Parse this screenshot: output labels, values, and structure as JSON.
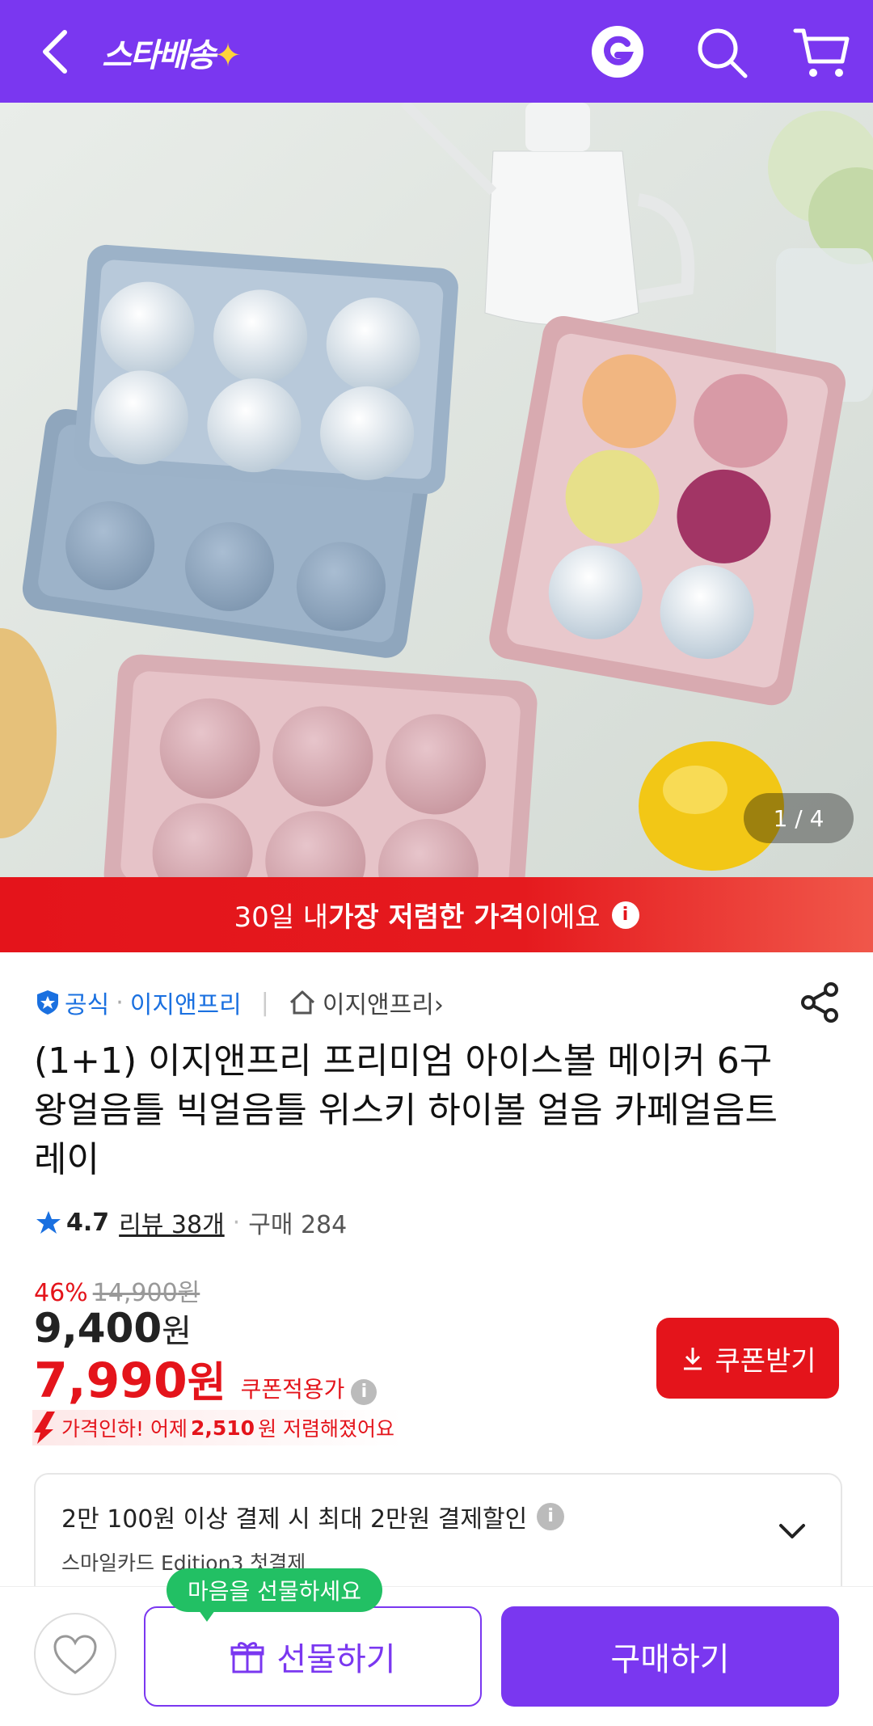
{
  "topbar": {
    "logo_text": "스타배송",
    "logo_spark": "✦",
    "icons": [
      "back-arrow-icon",
      "g-logo-icon",
      "search-icon",
      "cart-icon"
    ]
  },
  "hero": {
    "pager": "1 / 4",
    "image": "ice ball maker trays product photo"
  },
  "banner": {
    "prefix": "30일 내 ",
    "bold": "가장 저렴한 가격",
    "suffix": "이에요",
    "info": "i"
  },
  "seller": {
    "official_label": "공식",
    "brand": "이지앤프리",
    "store_name": "이지앤프리",
    "store_arrow": "›"
  },
  "product": {
    "title": "(1+1) 이지앤프리 프리미엄 아이스볼 메이커 6구 왕얼음틀 빅얼음틀 위스키 하이볼 얼음 카페얼음트레이",
    "rating": "4.7",
    "review": "리뷰 38개",
    "purchase": "구매 284"
  },
  "price": {
    "discount_rate": "46%",
    "original": "14,900",
    "original_unit": "원",
    "sale": "9,400",
    "sale_unit": "원",
    "coupon_price": "7,990",
    "coupon_unit": "원",
    "coupon_label": "쿠폰적용가",
    "coupon_info": "i",
    "coupon_button": "쿠폰받기",
    "drop_prefix": "가격인하! 어제",
    "drop_amount": "2,510",
    "drop_suffix": "원 저렴해졌어요"
  },
  "benefit": {
    "main": "2만 100원 이상 결제 시 최대 2만원 결제할인",
    "info": "i",
    "sub": "스마일카드 Edition3 첫결제"
  },
  "bottom": {
    "tooltip": "마음을 선물하세요",
    "gift_button": "선물하기",
    "buy_button": "구매하기"
  },
  "colors": {
    "brand_purple": "#7a37f0",
    "sale_red": "#e4141b",
    "tooltip_green": "#22c064",
    "link_blue": "#1a70e0"
  }
}
